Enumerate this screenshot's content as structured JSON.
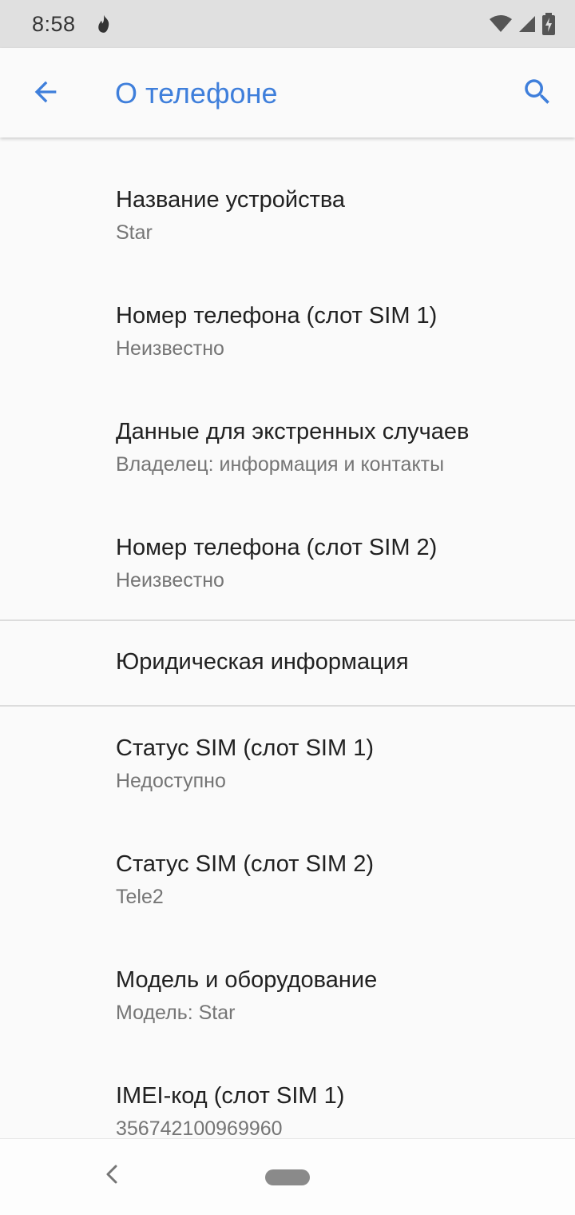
{
  "status_bar": {
    "time": "8:58",
    "icons": [
      "fire-notification-icon",
      "wifi-icon",
      "cell-signal-icon",
      "battery-charging-icon"
    ]
  },
  "app_bar": {
    "title": "О телефоне",
    "back_icon": "arrow-back-icon",
    "search_icon": "search-icon",
    "accent_color": "#3f7fdb"
  },
  "items": [
    {
      "title": "Название устройства",
      "subtitle": "Star"
    },
    {
      "title": "Номер телефона (слот SIM 1)",
      "subtitle": "Неизвестно"
    },
    {
      "title": "Данные для экстренных случаев",
      "subtitle": "Владелец: информация и контакты"
    },
    {
      "title": "Номер телефона (слот SIM 2)",
      "subtitle": "Неизвестно"
    },
    {
      "title": "Юридическая информация"
    },
    {
      "title": "Статус SIM (слот SIM 1)",
      "subtitle": "Недоступно"
    },
    {
      "title": "Статус SIM (слот SIM 2)",
      "subtitle": "Tele2"
    },
    {
      "title": "Модель и оборудование",
      "subtitle": "Модель: Star"
    },
    {
      "title": "IMEI-код (слот SIM 1)",
      "subtitle": "356742100969960"
    }
  ],
  "nav_bar": {
    "back_icon": "nav-back-icon",
    "home_icon": "home-pill-icon"
  }
}
